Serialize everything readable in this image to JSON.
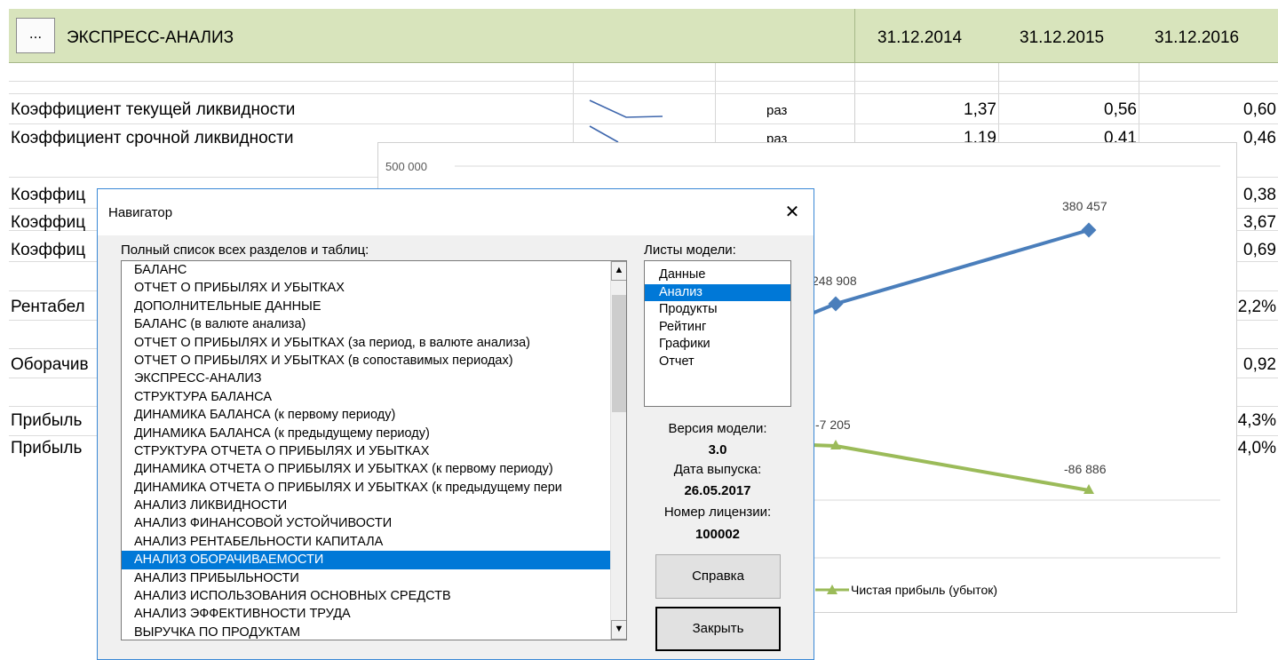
{
  "sheet": {
    "header": {
      "menu_button": "...",
      "title": "ЭКСПРЕСС-АНАЛИЗ",
      "dates": [
        "31.12.2014",
        "31.12.2015",
        "31.12.2016"
      ],
      "accent": "#d8e4bc"
    },
    "rows": {
      "current_ratio": {
        "label": "Коэффициент текущей ликвидности",
        "unit": "раз",
        "values": [
          "1,37",
          "0,56",
          "0,60"
        ]
      },
      "quick_ratio": {
        "label": "Коэффициент срочной ликвидности",
        "unit": "раз",
        "values": [
          "1,19",
          "0,41",
          "0,46"
        ]
      },
      "r3": {
        "label": "Коэффиц",
        "value": "0,38"
      },
      "r4": {
        "label": "Коэффиц",
        "value": "3,67"
      },
      "r5": {
        "label": "Коэффиц",
        "value": "0,69"
      },
      "r6": {
        "label": "Рентабел",
        "value": "2,2%"
      },
      "r7": {
        "label": "Оборачив",
        "value": "0,92"
      },
      "r8": {
        "label": "Прибыль",
        "value": "4,3%"
      },
      "r9": {
        "label": "Прибыль",
        "value": "4,0%"
      }
    }
  },
  "chart": {
    "y_tick": "500 000",
    "labels": {
      "blue_a": "248 908",
      "blue_b": "380 457",
      "green_a": "-7 205",
      "green_b": "-86 886"
    },
    "legend_green": "Чистая прибыль (убыток)",
    "colors": {
      "blue": "#4a7ebb",
      "green": "#9bbb59"
    }
  },
  "chart_data": {
    "type": "line",
    "series": [
      {
        "values": [
          248908,
          380457
        ]
      },
      {
        "name": "Чистая прибыль (убыток)",
        "values": [
          -7205,
          -86886
        ]
      }
    ]
  },
  "dialog": {
    "title": "Навигатор",
    "close": "✕",
    "list_label": "Полный список всех разделов и таблиц:",
    "sections": [
      "БАЛАНС",
      "ОТЧЕТ О ПРИБЫЛЯХ И УБЫТКАХ",
      "ДОПОЛНИТЕЛЬНЫЕ ДАННЫЕ",
      "БАЛАНС (в валюте анализа)",
      "ОТЧЕТ О ПРИБЫЛЯХ И УБЫТКАХ (за период, в валюте анализа)",
      "ОТЧЕТ О ПРИБЫЛЯХ И УБЫТКАХ (в сопоставимых периодах)",
      "ЭКСПРЕСС-АНАЛИЗ",
      "СТРУКТУРА БАЛАНСА",
      "ДИНАМИКА БАЛАНСА (к первому периоду)",
      "ДИНАМИКА БАЛАНСА (к предыдущему периоду)",
      "СТРУКТУРА ОТЧЕТА О ПРИБЫЛЯХ И УБЫТКАХ",
      "ДИНАМИКА ОТЧЕТА О ПРИБЫЛЯХ И УБЫТКАХ (к первому периоду)",
      "ДИНАМИКА ОТЧЕТА О ПРИБЫЛЯХ И УБЫТКАХ (к предыдущему пери",
      "АНАЛИЗ ЛИКВИДНОСТИ",
      "АНАЛИЗ ФИНАНСОВОЙ УСТОЙЧИВОСТИ",
      "АНАЛИЗ РЕНТАБЕЛЬНОСТИ КАПИТАЛА",
      "АНАЛИЗ ОБОРАЧИВАЕМОСТИ",
      "АНАЛИЗ ПРИБЫЛЬНОСТИ",
      "АНАЛИЗ ИСПОЛЬЗОВАНИЯ ОСНОВНЫХ СРЕДСТВ",
      "АНАЛИЗ ЭФФЕКТИВНОСТИ ТРУДА",
      "ВЫРУЧКА ПО ПРОДУКТАМ"
    ],
    "selected_section": "АНАЛИЗ ОБОРАЧИВАЕМОСТИ",
    "sheets_label": "Листы модели:",
    "sheets": [
      "Данные",
      "Анализ",
      "Продукты",
      "Рейтинг",
      "Графики",
      "Отчет"
    ],
    "selected_sheet": "Анализ",
    "version_label": "Версия модели:",
    "version": "3.0",
    "release_label": "Дата выпуска:",
    "release": "26.05.2017",
    "license_label": "Номер лицензии:",
    "license": "100002",
    "help_button": "Справка",
    "close_button": "Закрыть",
    "scroll_up": "▲",
    "scroll_down": "▼",
    "selection_color": "#0078d7"
  }
}
